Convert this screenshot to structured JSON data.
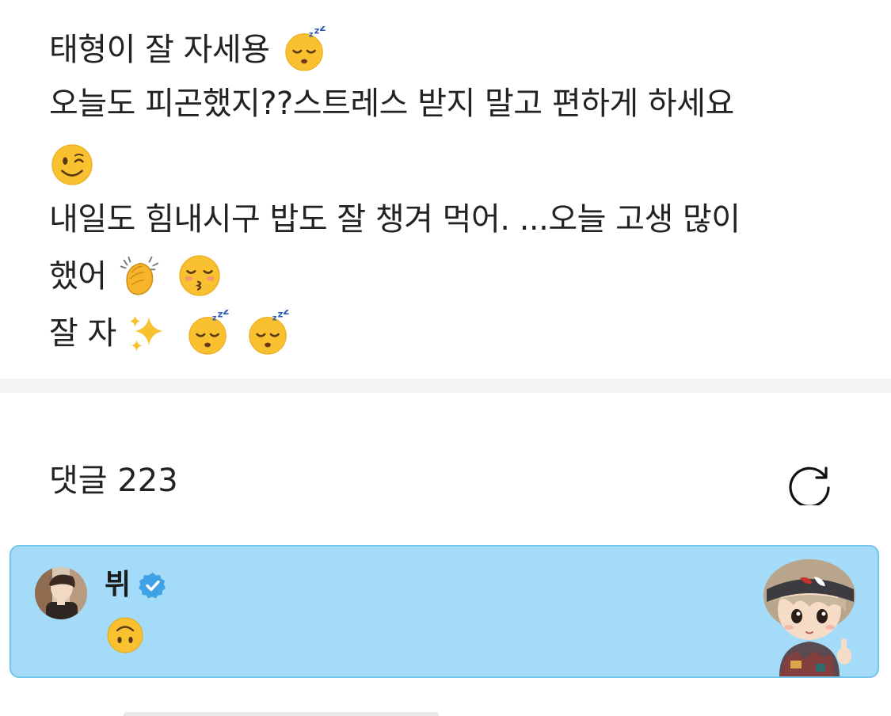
{
  "post": {
    "lines": [
      "태형이 잘 자세용",
      "오늘도 피곤했지??스트레스 받지 말고 편하게 하세요",
      "내일도 힘내시구 밥도 잘 챙겨 먹어. ...오늘 고생 많이",
      "했어",
      "잘 자"
    ],
    "emojis": {
      "line1": [
        "sleeping-face"
      ],
      "line3": [
        "winking-face"
      ],
      "line5": [
        "clapping-hands",
        "kissing-face-closed-eyes"
      ],
      "line6": [
        "sparkles",
        "sleeping-face",
        "sleeping-face"
      ]
    }
  },
  "comments": {
    "title": "댓글 223",
    "refresh_icon": "refresh-icon"
  },
  "highlighted_comment": {
    "author": "뷔",
    "verified": true,
    "text_emoji": "upside-down-face",
    "sticker": "chibi-character-sticker",
    "background_color": "#a3dbf8",
    "border_color": "#74c5ec"
  },
  "colors": {
    "text": "#222222",
    "divider": "#f4f4f7",
    "verified_badge": "#3fa1e6",
    "emoji_yellow": "#f9c12f"
  }
}
